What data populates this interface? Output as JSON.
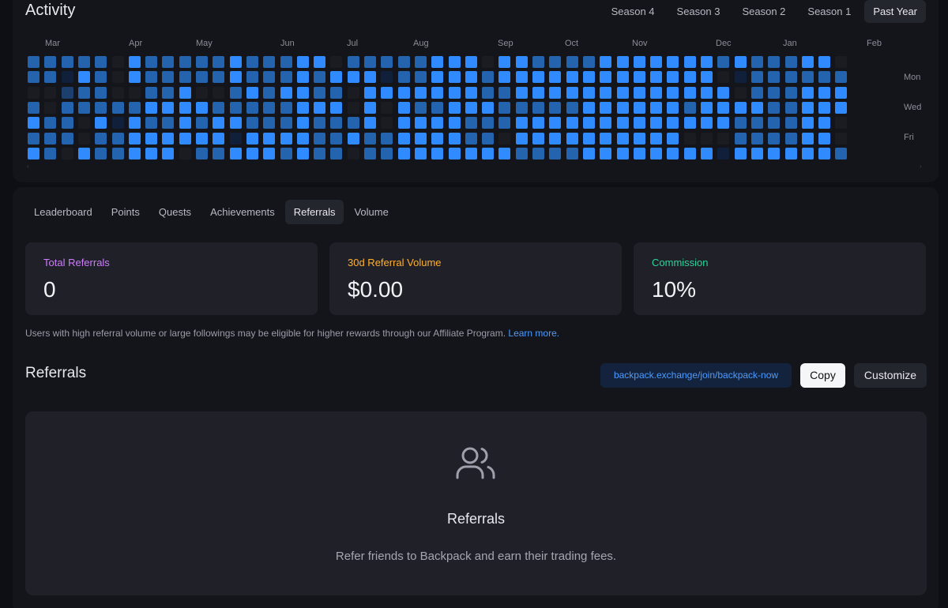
{
  "activity": {
    "title": "Activity",
    "seasons": [
      "Season 4",
      "Season 3",
      "Season 2",
      "Season 1",
      "Past Year"
    ],
    "active_season": "Past Year",
    "months": [
      "Mar",
      "Apr",
      "May",
      "Jun",
      "Jul",
      "Aug",
      "Sep",
      "Oct",
      "Nov",
      "Dec",
      "Jan",
      "Feb"
    ],
    "day_labels": [
      "Mon",
      "Wed",
      "Fri"
    ],
    "colors": [
      "#1b1c22",
      "#10203a",
      "#1d3f6e",
      "#2463ad",
      "#2f8bff"
    ],
    "grid": [
      "3333304333334333440333334440443333444444434333440",
      "3314304333334333434441334443444444444444401333333",
      "0023300334003434433044444443344444444444440333444",
      "3033333444433333444040433444333334444443444433444",
      "4330414334344333433340444433344444444444443333440",
      "3330334444441444433433444433044444444440003333440",
      "4304334440334443433033444444433334444444414444443"
    ]
  },
  "tabs": [
    "Leaderboard",
    "Points",
    "Quests",
    "Achievements",
    "Referrals",
    "Volume"
  ],
  "active_tab": "Referrals",
  "stats": [
    {
      "label": "Total Referrals",
      "value": "0",
      "color": "#d07bff"
    },
    {
      "label": "30d Referral Volume",
      "value": "$0.00",
      "color": "#ffb02e"
    },
    {
      "label": "Commission",
      "value": "10%",
      "color": "#29d49a"
    }
  ],
  "note": {
    "text": "Users with high referral volume or large followings may be eligible for higher rewards through our Affiliate Program.",
    "link": "Learn more."
  },
  "referrals": {
    "title": "Referrals",
    "link": "backpack.exchange/join/backpack-now",
    "copy_label": "Copy",
    "customize_label": "Customize",
    "empty_title": "Referrals",
    "empty_subtitle": "Refer friends to Backpack and earn their trading fees."
  }
}
